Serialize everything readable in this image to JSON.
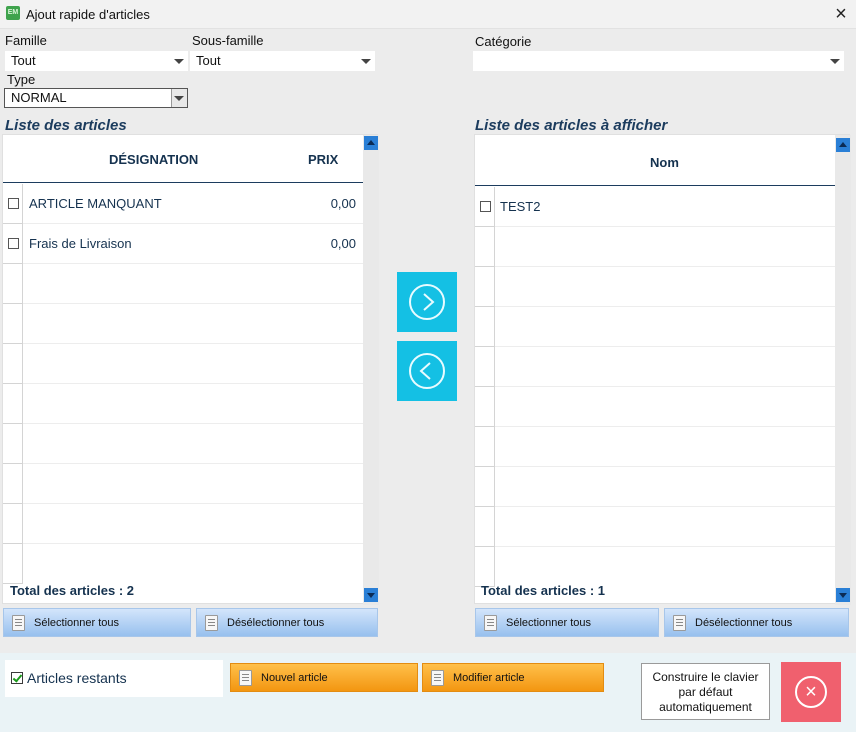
{
  "window": {
    "title": "Ajout rapide d'articles",
    "close_glyph": "×"
  },
  "filters": {
    "famille_label": "Famille",
    "famille_value": "Tout",
    "sous_famille_label": "Sous-famille",
    "sous_famille_value": "Tout",
    "categorie_label": "Catégorie",
    "categorie_value": "",
    "type_label": "Type",
    "type_value": "NORMAL"
  },
  "left_list": {
    "title": "Liste des articles",
    "col_designation": "DÉSIGNATION",
    "col_prix": "PRIX",
    "rows": [
      {
        "designation": "ARTICLE MANQUANT",
        "prix": "0,00"
      },
      {
        "designation": "Frais de Livraison",
        "prix": "0,00"
      }
    ],
    "total": "Total des articles : 2",
    "select_all": "Sélectionner tous",
    "deselect_all": "Désélectionner tous"
  },
  "right_list": {
    "title": "Liste des articles à afficher",
    "col_nom": "Nom",
    "rows": [
      {
        "nom": "TEST2"
      }
    ],
    "total": "Total des articles : 1",
    "select_all": "Sélectionner tous",
    "deselect_all": "Désélectionner tous"
  },
  "bottom": {
    "articles_restants": "Articles restants",
    "articles_restants_checked": true,
    "nouvel_article": "Nouvel article",
    "modifier_article": "Modifier article",
    "build_line1": "Construire le clavier",
    "build_line2": "par défaut",
    "build_line3": "automatiquement"
  },
  "colors": {
    "nav_button": "#14c0e4",
    "exit_button": "#f0606e",
    "orange_button": "#f7a21c",
    "blue_button": "#b7d4f6",
    "header_text": "#15324f"
  },
  "icons": {
    "move_right": "chevron-right-circle-icon",
    "move_left": "chevron-left-circle-icon",
    "exit": "close-circle-icon"
  }
}
